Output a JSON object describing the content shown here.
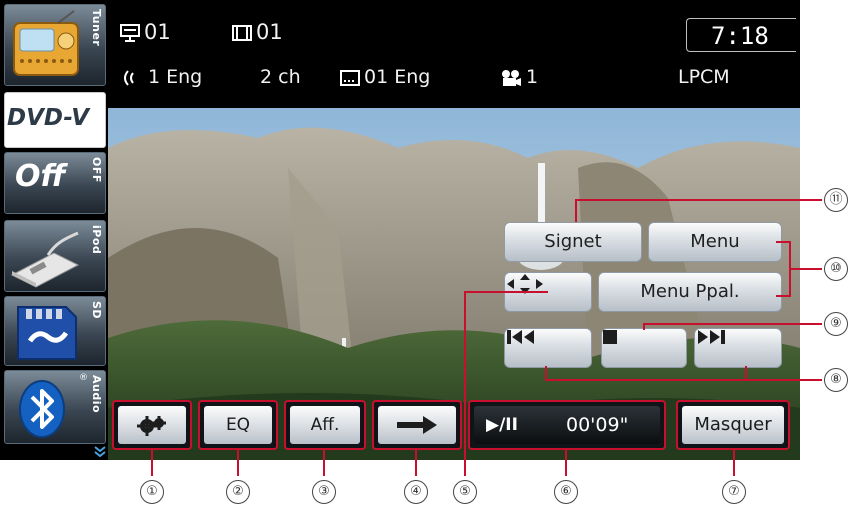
{
  "sidebar": {
    "tuner_label": "Tuner",
    "active_source": "DVD-V",
    "off_text": "Off",
    "off_label": "OFF",
    "ipod_label": "iPod",
    "sd_label": "SD",
    "audio_label": "Audio",
    "audio_mark": "®"
  },
  "info": {
    "title_num": "01",
    "chapter_num": "01",
    "clock": "7:18",
    "audio_track": "1 Eng",
    "channels": "2 ch",
    "subtitle": "01 Eng",
    "angle": "1",
    "audio_format": "LPCM"
  },
  "controls": {
    "signet": "Signet",
    "menu": "Menu",
    "menu_ppal": "Menu Ppal."
  },
  "bottom": {
    "eq": "EQ",
    "aff": "Aff.",
    "playpause": "▶/II",
    "time": "00'09\"",
    "masquer": "Masquer"
  },
  "callouts": [
    "①",
    "②",
    "③",
    "④",
    "⑤",
    "⑥",
    "⑦",
    "⑧",
    "⑨",
    "⑩",
    "⑪"
  ],
  "colors": {
    "callout_line": "#c8102e",
    "screen_bg": "#000000"
  }
}
